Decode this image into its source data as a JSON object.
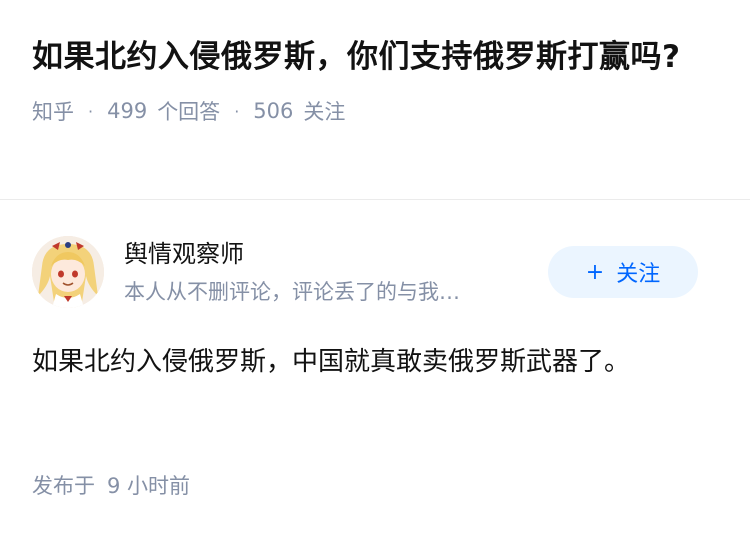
{
  "question": {
    "title": "如果北约入侵俄罗斯，你们支持俄罗斯打赢吗?",
    "source": "知乎",
    "answer_count": "499",
    "answer_count_label": "个回答",
    "follower_count": "506",
    "follower_count_label": "关注",
    "separator": "·"
  },
  "author": {
    "name": "舆情观察师",
    "bio": "本人从不删评论，评论丢了的与我…",
    "follow_plus": "+",
    "follow_label": "关注"
  },
  "answer": {
    "content": "如果北约入侵俄罗斯，中国就真敢卖俄罗斯武器了。",
    "posted_prefix": "发布于",
    "posted_time": "9 小时前"
  },
  "colors": {
    "title": "#121212",
    "meta": "#8590a6",
    "accent": "#0066ff",
    "follow_bg": "#ebf5ff",
    "divider": "#ebebeb"
  }
}
